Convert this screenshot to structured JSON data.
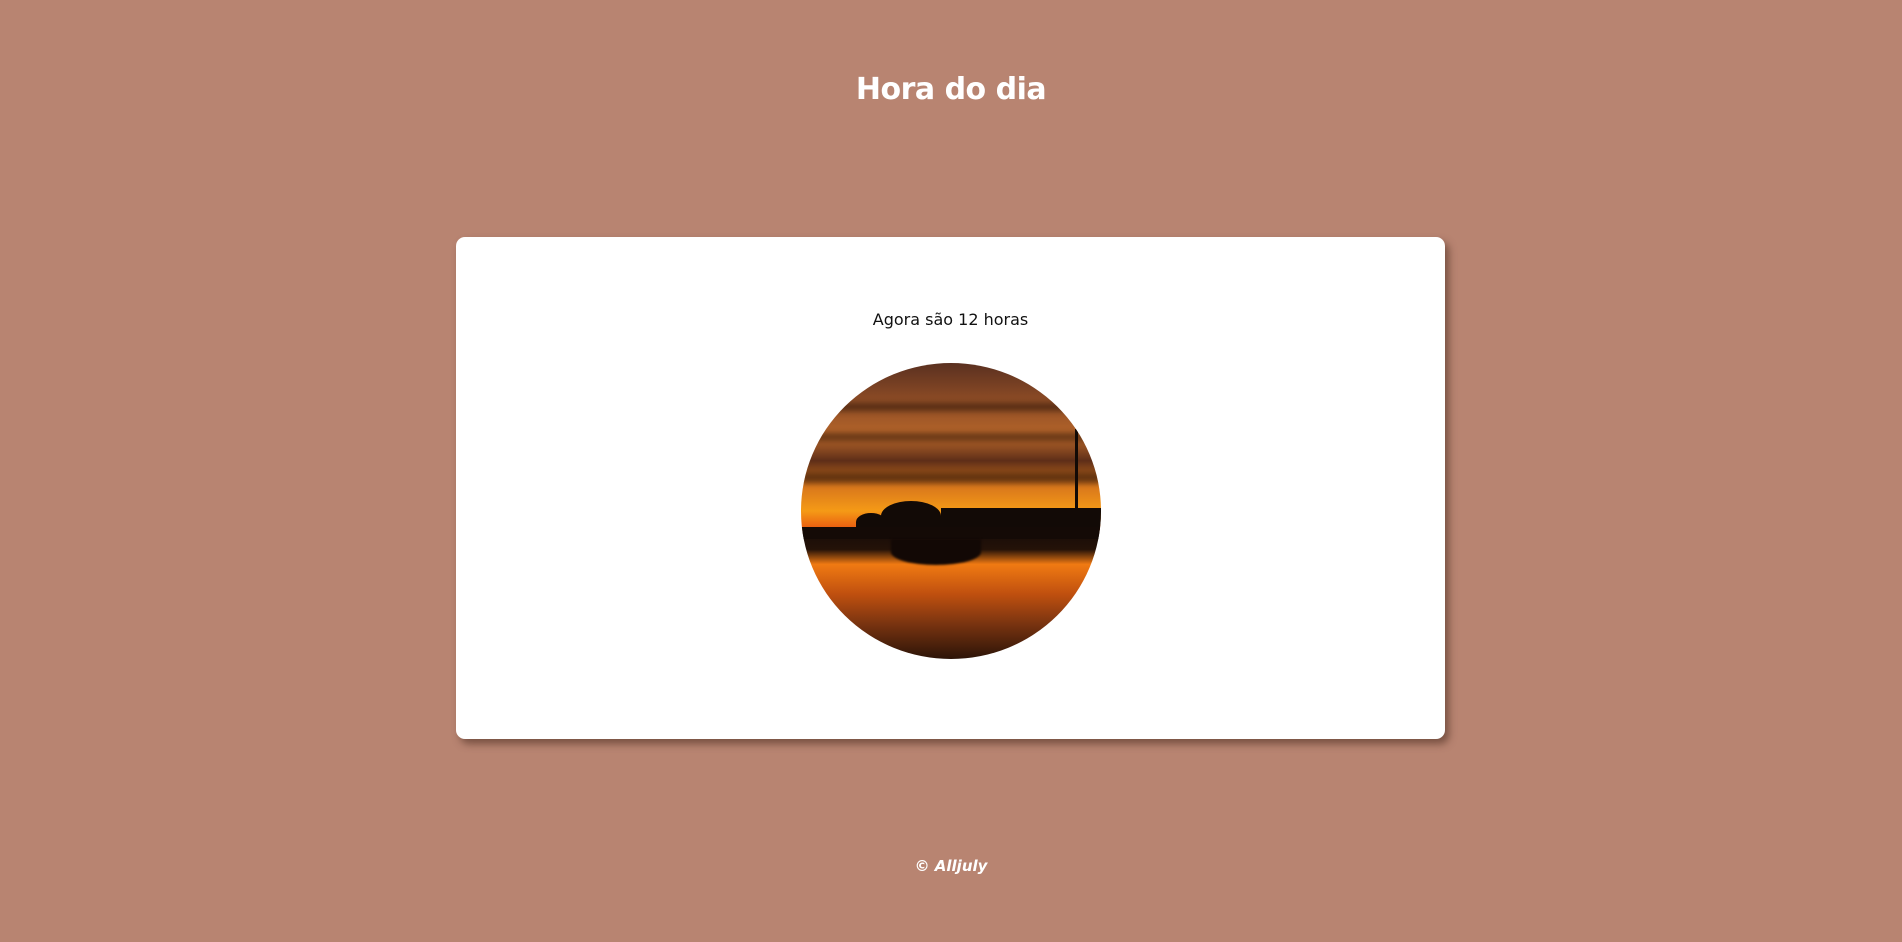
{
  "header": {
    "title": "Hora do dia"
  },
  "card": {
    "message": "Agora são 12 horas",
    "image": {
      "description_icon": "sunset-photo"
    }
  },
  "footer": {
    "copyright": "© Alljuly"
  },
  "colors": {
    "background": "#b88471",
    "card": "#ffffff",
    "title": "#ffffff"
  }
}
